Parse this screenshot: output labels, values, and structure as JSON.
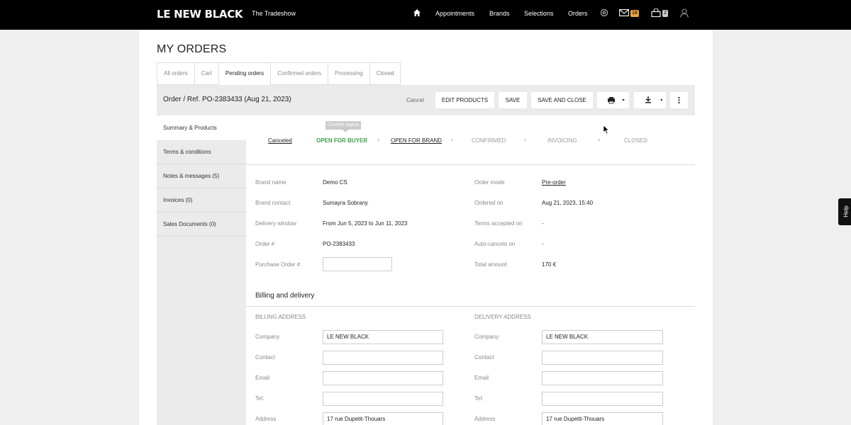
{
  "header": {
    "logo": "LE NEW BLACK",
    "subtitle": "The Tradeshow",
    "nav": [
      "Appointments",
      "Brands",
      "Selections",
      "Orders"
    ],
    "messages_count": "18",
    "cart_count": "2",
    "icons": [
      "home-icon",
      "settings-icon",
      "mail-icon",
      "cart-icon",
      "user-icon"
    ]
  },
  "page": {
    "title": "MY ORDERS",
    "tabs": [
      "All orders",
      "Cart",
      "Pending orders",
      "Confirmed orders",
      "Processing",
      "Closed"
    ],
    "active_tab": "Pending orders"
  },
  "order_bar": {
    "ref": "Order / Ref. PO-2383433 (Aug 21, 2023)",
    "cancel": "Cancel",
    "edit_products": "EDIT PRODUCTS",
    "save": "SAVE",
    "save_close": "SAVE AND CLOSE"
  },
  "sidebar": {
    "items": [
      "Summary & Products",
      "Terms & conditions",
      "Notes & messages (5)",
      "Invoices (0)",
      "Sales Documents (0)"
    ]
  },
  "status": {
    "tooltip": "Current status",
    "steps": [
      "Canceled",
      "OPEN FOR BUYER",
      "OPEN FOR BRAND",
      "CONFIRMED",
      "INVOICING",
      "CLOSED"
    ]
  },
  "details": {
    "brand_name_label": "Brand name",
    "brand_name": "Demo CS",
    "brand_contact_label": "Brand contact",
    "brand_contact": "Sumayra Sobrany",
    "delivery_label": "Delivery window",
    "delivery": "From Jun 5, 2023 to Jun 11, 2023",
    "order_no_label": "Order #",
    "order_no": "PO-2383433",
    "po_label": "Purchase Order #",
    "po_value": "",
    "order_mode_label": "Order mode",
    "order_mode": "Pre-order",
    "ordered_on_label": "Ordered on",
    "ordered_on": "Aug 21, 2023, 15:40",
    "terms_label": "Terms accepted on",
    "terms": "-",
    "auto_cancel_label": "Auto-cancels on",
    "auto_cancel": "-",
    "total_label": "Total amount",
    "total": "170 €"
  },
  "billing": {
    "section_title": "Billing and delivery",
    "billing_heading": "BILLING ADDRESS",
    "delivery_heading": "DELIVERY ADDRESS",
    "field_labels": [
      "Company",
      "Contact",
      "Email",
      "Tel.",
      "Address"
    ],
    "billing_values": [
      "LE NEW BLACK",
      "",
      "",
      "",
      "17 rue Dupetit-Thouars"
    ],
    "delivery_values": [
      "LE NEW BLACK",
      "",
      "",
      "",
      "17 rue Dupetit-Thouars"
    ]
  },
  "help": "Help"
}
